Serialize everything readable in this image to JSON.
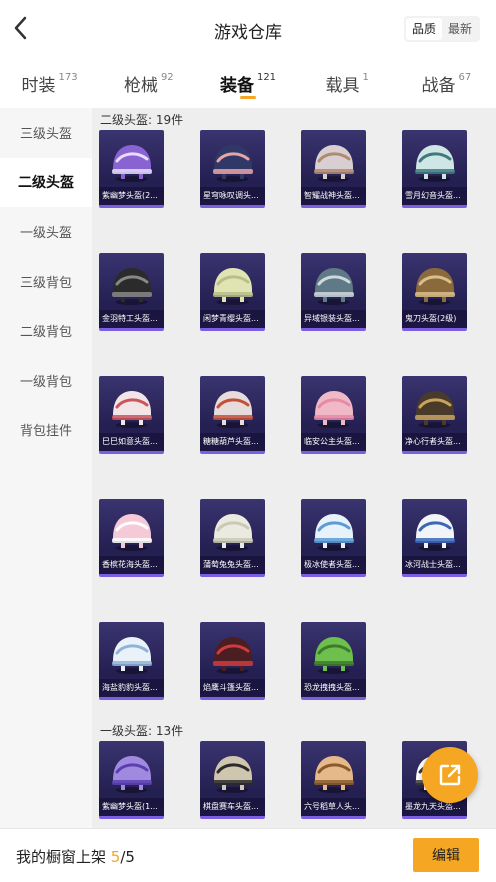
{
  "header": {
    "title": "游戏仓库",
    "sort_options": [
      "品质",
      "最新"
    ],
    "active_sort": "品质"
  },
  "tabs": [
    {
      "label": "时装",
      "count": "173"
    },
    {
      "label": "枪械",
      "count": "92"
    },
    {
      "label": "装备",
      "count": "121"
    },
    {
      "label": "载具",
      "count": "1"
    },
    {
      "label": "战备",
      "count": "67"
    }
  ],
  "active_tab": "装备",
  "accent_color": "#f5a623",
  "sidebar": {
    "items": [
      "三级头盔",
      "二级头盔",
      "一级头盔",
      "三级背包",
      "二级背包",
      "一级背包",
      "背包挂件"
    ],
    "active": "二级头盔"
  },
  "sections": [
    {
      "title": "二级头盔: 19件",
      "items": [
        {
          "name": "紫幽梦头盔(2...",
          "tint": "#8a63d2",
          "accent": "#e6ddff"
        },
        {
          "name": "星穹咏叹调头...",
          "tint": "#2f3866",
          "accent": "#e7a6a6"
        },
        {
          "name": "智耀战神头盔...",
          "tint": "#d9cfd2",
          "accent": "#b08a6d"
        },
        {
          "name": "雪月幻音头盔...",
          "tint": "#cfe6e6",
          "accent": "#3e7b7a"
        },
        {
          "name": "金羽特工头盔...",
          "tint": "#2b2b2b",
          "accent": "#888888"
        },
        {
          "name": "闲梦青缨头盔...",
          "tint": "#dfe4b2",
          "accent": "#b9bf8a"
        },
        {
          "name": "异域银装头盔...",
          "tint": "#5f7a86",
          "accent": "#cfd8dc"
        },
        {
          "name": "鬼刀头盔(2级)",
          "tint": "#8a6a3d",
          "accent": "#d9c08b"
        },
        {
          "name": "巳巳如意头盔...",
          "tint": "#f1e5e7",
          "accent": "#c9565a"
        },
        {
          "name": "糖糖葫芦头盔...",
          "tint": "#e7dcdc",
          "accent": "#c4503a"
        },
        {
          "name": "临安公主头盔...",
          "tint": "#f0b9c8",
          "accent": "#e78aa5"
        },
        {
          "name": "净心行者头盔...",
          "tint": "#4a3a2a",
          "accent": "#c9a35e"
        },
        {
          "name": "香槟花海头盔...",
          "tint": "#f5c9d6",
          "accent": "#ffffff"
        },
        {
          "name": "蒲萄兔兔头盔...",
          "tint": "#eaeae0",
          "accent": "#c9c9b5"
        },
        {
          "name": "极冰使者头盔...",
          "tint": "#e8f2fa",
          "accent": "#5c9bd6"
        },
        {
          "name": "冰河战士头盔...",
          "tint": "#f2f4f8",
          "accent": "#3c66b8"
        },
        {
          "name": "海盐豹豹头盔...",
          "tint": "#e9f2f8",
          "accent": "#8fb4d8"
        },
        {
          "name": "焰鹰斗篷头盔...",
          "tint": "#4a1e22",
          "accent": "#d23b3b"
        },
        {
          "name": "恐龙拽拽头盔...",
          "tint": "#6fbf4f",
          "accent": "#3d7d2a"
        }
      ]
    },
    {
      "title": "一级头盔: 13件",
      "items": [
        {
          "name": "紫幽梦头盔(1...",
          "tint": "#a08ae0",
          "accent": "#5b3fb0"
        },
        {
          "name": "棋盘赛车头盔...",
          "tint": "#cfc6b0",
          "accent": "#2a2a2a"
        },
        {
          "name": "六号稻草人头...",
          "tint": "#e6b98a",
          "accent": "#8a5a2b"
        },
        {
          "name": "墨龙九天头盔...",
          "tint": "#ffffff",
          "accent": "#3a3a3a"
        }
      ]
    }
  ],
  "bottom_bar": {
    "label": "我的橱窗上架",
    "current": "5",
    "total": "/5",
    "edit_label": "编辑"
  }
}
